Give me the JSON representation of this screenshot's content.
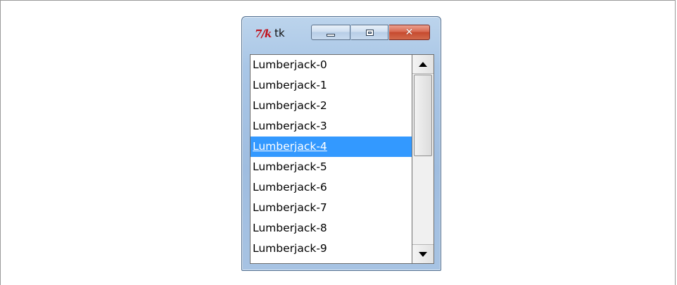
{
  "window": {
    "title": "tk",
    "icon_label": "7/k",
    "icon": "tk-feather-icon",
    "buttons": {
      "minimize": "minimize-icon",
      "maximize": "maximize-icon",
      "close": "close-icon",
      "close_glyph": "✕"
    }
  },
  "listbox": {
    "items": [
      "Lumberjack-0",
      "Lumberjack-1",
      "Lumberjack-2",
      "Lumberjack-3",
      "Lumberjack-4",
      "Lumberjack-5",
      "Lumberjack-6",
      "Lumberjack-7",
      "Lumberjack-8",
      "Lumberjack-9"
    ],
    "selected_index": 4,
    "selection_color": "#3399ff"
  },
  "scrollbar": {
    "up_icon": "scroll-up-arrow-icon",
    "down_icon": "scroll-down-arrow-icon"
  }
}
